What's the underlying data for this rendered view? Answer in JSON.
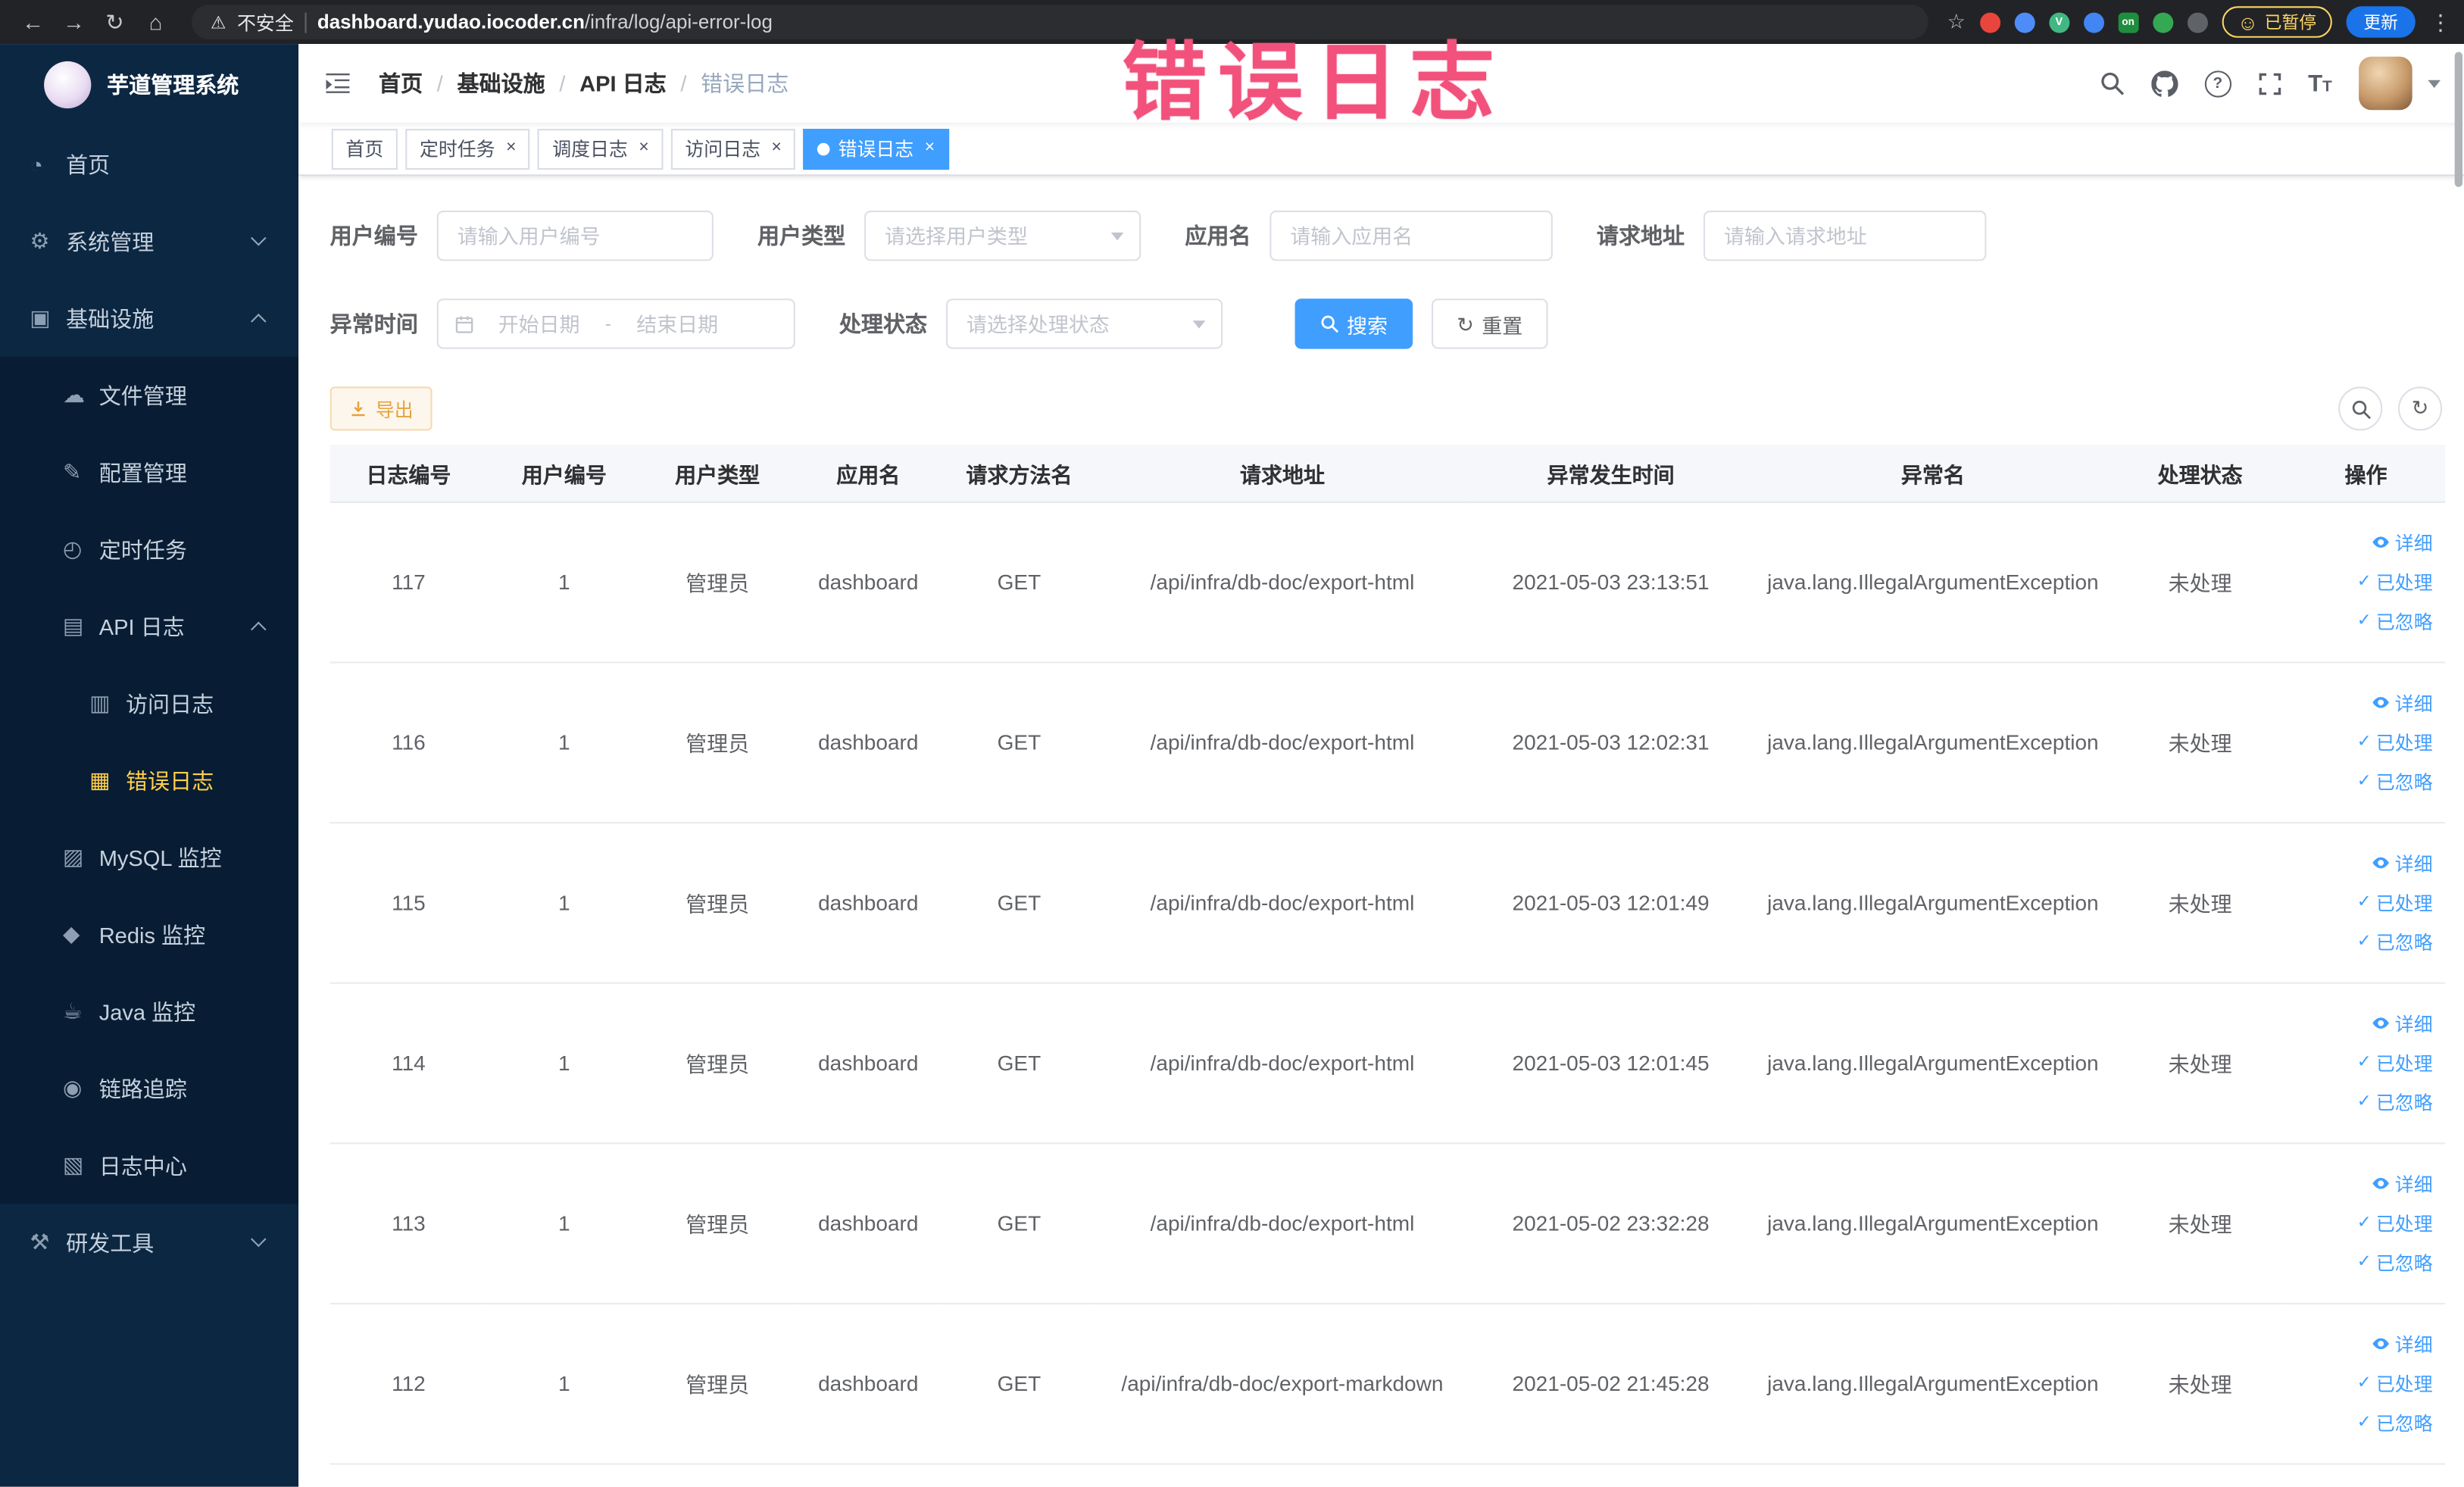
{
  "icons": {
    "close": "×",
    "check": "✓",
    "refresh": "↻",
    "smiley": "☺",
    "help": "?",
    "font_size": "T"
  },
  "colors": {
    "primary": "#409eff",
    "menu_active": "#ffd04b",
    "warning": "#e6a23c",
    "annotation_pink": "#f2517c",
    "sidebar_bg": "#0c2742",
    "submenu_bg": "#081d33"
  },
  "browser": {
    "back_icon": "←",
    "forward_icon": "→",
    "reload_icon": "↻",
    "home_icon": "⌂",
    "warning_icon": "⚠",
    "security_label": "不安全",
    "url_domain": "dashboard.yudao.iocoder.cn",
    "url_path": "/infra/log/api-error-log",
    "star_icon": "☆",
    "kebab_icon": "⋮",
    "paused_badge": "已暂停",
    "update_button": "更新",
    "extensions": [
      {
        "key": "red",
        "color": "#e8453c",
        "shape": "circle",
        "letter": ""
      },
      {
        "key": "blue",
        "color": "#4e8cf9",
        "shape": "circle",
        "letter": ""
      },
      {
        "key": "vue",
        "color": "#41b883",
        "shape": "circle",
        "letter": "V"
      },
      {
        "key": "grid",
        "color": "#4285f4",
        "shape": "circle",
        "letter": ""
      },
      {
        "key": "on",
        "color": "#1e8e3e",
        "shape": "square",
        "letter": "on"
      },
      {
        "key": "leaf",
        "color": "#34a853",
        "shape": "circle",
        "letter": ""
      },
      {
        "key": "dark",
        "color": "#5f6368",
        "shape": "circle",
        "letter": ""
      }
    ]
  },
  "annotation": {
    "text": "错误日志"
  },
  "sidebar": {
    "logo_title": "芋道管理系统",
    "menu": [
      {
        "key": "home",
        "label": "首页",
        "icon": "dashboard-icon",
        "glyph": "◔",
        "level": 1
      },
      {
        "key": "system",
        "label": "系统管理",
        "icon": "gear-icon",
        "glyph": "⚙",
        "level": 1,
        "arrow": "down"
      },
      {
        "key": "infra",
        "label": "基础设施",
        "icon": "infrastructure-icon",
        "glyph": "▣",
        "level": 1,
        "arrow": "up"
      },
      {
        "key": "file",
        "label": "文件管理",
        "icon": "cloud-icon",
        "glyph": "☁",
        "level": 2
      },
      {
        "key": "config",
        "label": "配置管理",
        "icon": "pencil-icon",
        "glyph": "✎",
        "level": 2
      },
      {
        "key": "job",
        "label": "定时任务",
        "icon": "timer-icon",
        "glyph": "◴",
        "level": 2
      },
      {
        "key": "api-log",
        "label": "API 日志",
        "icon": "api-log-icon",
        "glyph": "▤",
        "level": 2,
        "arrow": "up"
      },
      {
        "key": "access-log",
        "label": "访问日志",
        "icon": "access-log-icon",
        "glyph": "▥",
        "level": 3
      },
      {
        "key": "error-log",
        "label": "错误日志",
        "icon": "error-log-icon",
        "glyph": "▦",
        "level": 3,
        "active": true
      },
      {
        "key": "mysql",
        "label": "MySQL 监控",
        "icon": "database-icon",
        "glyph": "▨",
        "level": 2
      },
      {
        "key": "redis",
        "label": "Redis 监控",
        "icon": "redis-icon",
        "glyph": "◆",
        "level": 2
      },
      {
        "key": "java",
        "label": "Java 监控",
        "icon": "java-monitor-icon",
        "glyph": "☕",
        "level": 2
      },
      {
        "key": "tracer",
        "label": "链路追踪",
        "icon": "trace-eye-icon",
        "glyph": "◉",
        "level": 2
      },
      {
        "key": "log-center",
        "label": "日志中心",
        "icon": "log-center-icon",
        "glyph": "▧",
        "level": 2
      },
      {
        "key": "dev-tools",
        "label": "研发工具",
        "icon": "tools-icon",
        "glyph": "⚒",
        "level": 1,
        "arrow": "down"
      }
    ]
  },
  "header": {
    "breadcrumb": [
      {
        "key": "home",
        "label": "首页",
        "current": false
      },
      {
        "key": "infra",
        "label": "基础设施",
        "current": false
      },
      {
        "key": "api-log",
        "label": "API 日志",
        "current": false
      },
      {
        "key": "error-log",
        "label": "错误日志",
        "current": true
      }
    ]
  },
  "tags_view": [
    {
      "key": "home",
      "label": "首页",
      "closable": false,
      "active": false
    },
    {
      "key": "job",
      "label": "定时任务",
      "closable": true,
      "active": false
    },
    {
      "key": "job-log",
      "label": "调度日志",
      "closable": true,
      "active": false
    },
    {
      "key": "access-log",
      "label": "访问日志",
      "closable": true,
      "active": false
    },
    {
      "key": "error-log",
      "label": "错误日志",
      "closable": true,
      "active": true
    }
  ],
  "filters": {
    "user_id": {
      "label": "用户编号",
      "placeholder": "请输入用户编号"
    },
    "user_type": {
      "label": "用户类型",
      "placeholder": "请选择用户类型"
    },
    "app_name": {
      "label": "应用名",
      "placeholder": "请输入应用名"
    },
    "request_url": {
      "label": "请求地址",
      "placeholder": "请输入请求地址"
    },
    "exception_time": {
      "label": "异常时间",
      "start_placeholder": "开始日期",
      "separator": "-",
      "end_placeholder": "结束日期"
    },
    "process_status": {
      "label": "处理状态",
      "placeholder": "请选择处理状态"
    },
    "search_button": "搜索",
    "reset_button": "重置"
  },
  "toolbar": {
    "export_button": "导出"
  },
  "table": {
    "columns": [
      {
        "key": "id",
        "label": "日志编号"
      },
      {
        "key": "user_id",
        "label": "用户编号"
      },
      {
        "key": "user_type",
        "label": "用户类型"
      },
      {
        "key": "app_name",
        "label": "应用名"
      },
      {
        "key": "method",
        "label": "请求方法名"
      },
      {
        "key": "url",
        "label": "请求地址"
      },
      {
        "key": "time",
        "label": "异常发生时间"
      },
      {
        "key": "exception",
        "label": "异常名"
      },
      {
        "key": "status",
        "label": "处理状态"
      },
      {
        "key": "actions",
        "label": "操作"
      }
    ],
    "rows": [
      {
        "id": "117",
        "user_id": "1",
        "user_type": "管理员",
        "app_name": "dashboard",
        "method": "GET",
        "url": "/api/infra/db-doc/export-html",
        "time": "2021-05-03 23:13:51",
        "exception": "java.lang.IllegalArgumentException",
        "status": "未处理"
      },
      {
        "id": "116",
        "user_id": "1",
        "user_type": "管理员",
        "app_name": "dashboard",
        "method": "GET",
        "url": "/api/infra/db-doc/export-html",
        "time": "2021-05-03 12:02:31",
        "exception": "java.lang.IllegalArgumentException",
        "status": "未处理"
      },
      {
        "id": "115",
        "user_id": "1",
        "user_type": "管理员",
        "app_name": "dashboard",
        "method": "GET",
        "url": "/api/infra/db-doc/export-html",
        "time": "2021-05-03 12:01:49",
        "exception": "java.lang.IllegalArgumentException",
        "status": "未处理"
      },
      {
        "id": "114",
        "user_id": "1",
        "user_type": "管理员",
        "app_name": "dashboard",
        "method": "GET",
        "url": "/api/infra/db-doc/export-html",
        "time": "2021-05-03 12:01:45",
        "exception": "java.lang.IllegalArgumentException",
        "status": "未处理"
      },
      {
        "id": "113",
        "user_id": "1",
        "user_type": "管理员",
        "app_name": "dashboard",
        "method": "GET",
        "url": "/api/infra/db-doc/export-html",
        "time": "2021-05-02 23:32:28",
        "exception": "java.lang.IllegalArgumentException",
        "status": "未处理"
      },
      {
        "id": "112",
        "user_id": "1",
        "user_type": "管理员",
        "app_name": "dashboard",
        "method": "GET",
        "url": "/api/infra/db-doc/export-markdown",
        "time": "2021-05-02 21:45:28",
        "exception": "java.lang.IllegalArgumentException",
        "status": "未处理"
      }
    ],
    "row_actions": [
      {
        "key": "detail",
        "label": "详细",
        "icon": "eye-icon"
      },
      {
        "key": "processed",
        "label": "已处理",
        "icon": "check-icon"
      },
      {
        "key": "ignored",
        "label": "已忽略",
        "icon": "check-icon"
      }
    ]
  }
}
